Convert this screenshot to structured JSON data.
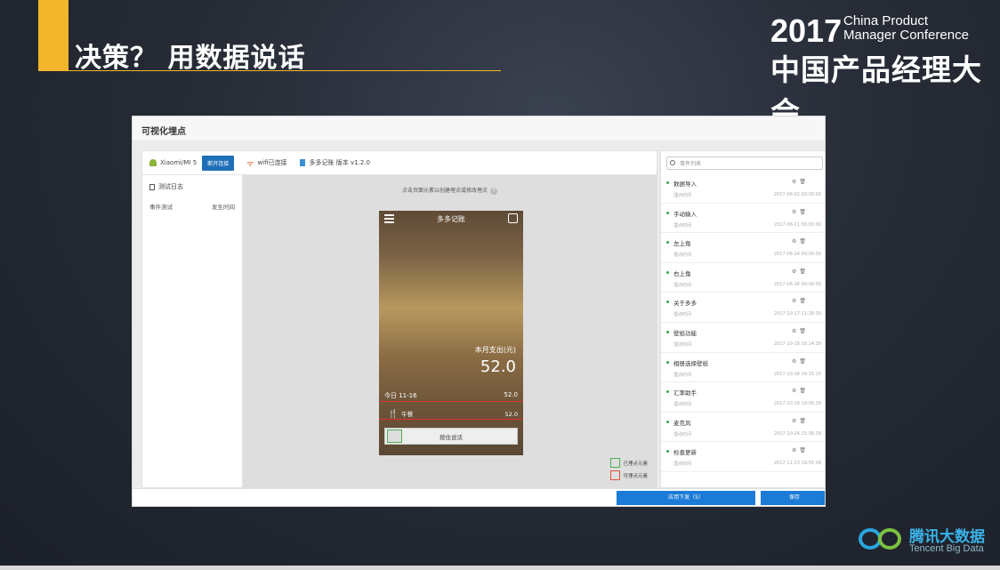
{
  "slide": {
    "title": "决策？ 用数据说话",
    "accent_color": "#f3b62a",
    "conference_year": "2017",
    "conference_en_line1": "China Product",
    "conference_en_line2": "Manager Conference",
    "conference_cn": "中国产品经理大会"
  },
  "app": {
    "title": "可视化埋点",
    "device_name": "Xiaomi/MI 5",
    "disconnect_label": "断开连接",
    "wifi_label": "wifi已连接",
    "app_version": "多多记账 版本 v1.2.0",
    "log_title": "测试日志",
    "log_col_event": "事件测试",
    "log_col_time": "发生时间",
    "hint": "点击页面元素以创建埋点或修改埋点",
    "search_placeholder": "事件列表",
    "apply_label": "应用下发（5）",
    "save_label": "保存",
    "legend_tracked": "已埋点元素",
    "legend_trackable": "可埋点元素"
  },
  "phone": {
    "app_title": "多多记账",
    "month_label": "本月支出(元)",
    "month_value": "52.0",
    "today_label": "今日  11-16",
    "today_value": "52.0",
    "lunch_label": "午餐",
    "lunch_value": "52.0",
    "voice_button": "按住说话"
  },
  "events": [
    {
      "name": "数据导入",
      "sub": "埋点时间",
      "time": "2017-06-02 00:00:00"
    },
    {
      "name": "手动输入",
      "sub": "埋点时间",
      "time": "2017-06-11 00:00:00"
    },
    {
      "name": "左上角",
      "sub": "埋点时间",
      "time": "2017-06-24 00:00:00"
    },
    {
      "name": "右上角",
      "sub": "埋点时间",
      "time": "2017-06-26 00:00:00"
    },
    {
      "name": "关于多多",
      "sub": "埋点时间",
      "time": "2017-10-17 11:28:30"
    },
    {
      "name": "壁纸功能",
      "sub": "埋点时间",
      "time": "2017-10-18 16:14:39"
    },
    {
      "name": "相册选择壁纸",
      "sub": "埋点时间",
      "time": "2017-10-18 16:15:15"
    },
    {
      "name": "汇率助手",
      "sub": "埋点时间",
      "time": "2017-10-18 19:05:39"
    },
    {
      "name": "麦克风",
      "sub": "埋点时间",
      "time": "2017-10-24 15:06:38"
    },
    {
      "name": "检查更新",
      "sub": "埋点时间",
      "time": "2017-11-13 18:55:38"
    }
  ],
  "footer": {
    "brand_cn": "腾讯大数据",
    "brand_en": "Tencent Big Data"
  }
}
